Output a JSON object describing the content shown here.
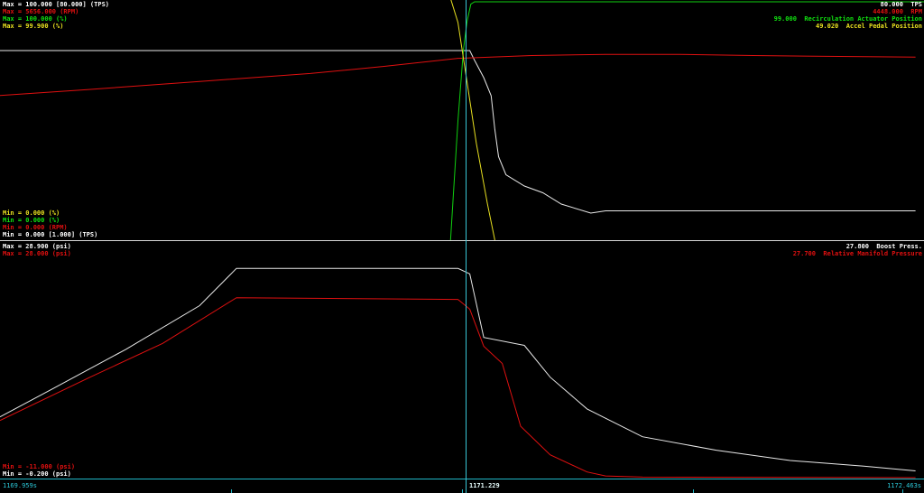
{
  "top_panel": {
    "left_labels": [
      {
        "text": "Max = 100.000 [80.000] (TPS)",
        "color": "#ffffff"
      },
      {
        "text": "Max = 5656.000 (RPM)",
        "color": "#e01010"
      },
      {
        "text": "Max = 100.000 (%)",
        "color": "#10e010"
      },
      {
        "text": "Max = 99.900 (%)",
        "color": "#e8e020"
      }
    ],
    "bottom_left_labels": [
      {
        "text": "Min = 0.000 (%)",
        "color": "#e8e020"
      },
      {
        "text": "Min = 0.000 (%)",
        "color": "#10e010"
      },
      {
        "text": "Min = 0.000 (RPM)",
        "color": "#e01010"
      },
      {
        "text": "Min = 0.000 [1.000] (TPS)",
        "color": "#ffffff"
      }
    ],
    "right_labels": [
      {
        "text": "80.000  TPS",
        "color": "#ffffff"
      },
      {
        "text": "4448.000  RPM",
        "color": "#e01010"
      },
      {
        "text": "99.000  Recirculation Actuator Position",
        "color": "#10e010"
      },
      {
        "text": "49.020  Accel Pedal Position",
        "color": "#e8e020"
      }
    ]
  },
  "bottom_panel": {
    "left_labels": [
      {
        "text": "Max = 28.900 (psi)",
        "color": "#ffffff"
      },
      {
        "text": "Max = 28.000 (psi)",
        "color": "#e01010"
      }
    ],
    "bottom_left_labels": [
      {
        "text": "Min = -11.000 (psi)",
        "color": "#e01010"
      },
      {
        "text": "Min = -0.200 (psi)",
        "color": "#ffffff"
      }
    ],
    "right_labels": [
      {
        "text": "27.800  Boost Press.",
        "color": "#ffffff"
      },
      {
        "text": "27.700  Relative Manifold Pressure",
        "color": "#e01010"
      }
    ]
  },
  "timebar": {
    "start": "1169.959s",
    "cursor": "1171.229",
    "end": "1172.463s"
  },
  "colors": {
    "tps": "#e8e8e8",
    "rpm": "#e01010",
    "recirc": "#10d010",
    "pedal": "#e8e020",
    "boost": "#e8e8e8",
    "manifold": "#e01010",
    "cursor": "#39c6d6"
  },
  "chart_data": [
    {
      "type": "line",
      "title": "",
      "xlim": [
        1169.959,
        1172.463
      ],
      "series": [
        {
          "name": "TPS",
          "color": "#e8e8e8",
          "x": [
            1169.959,
            1171.232,
            1171.244,
            1171.27,
            1171.29,
            1171.3,
            1171.31,
            1171.33,
            1171.38,
            1171.43,
            1171.48,
            1171.56,
            1171.6,
            1172.44
          ],
          "y": [
            80.0,
            80.0,
            76.0,
            68.0,
            60.0,
            45.0,
            33.0,
            25.0,
            20.0,
            17.0,
            12.0,
            8.0,
            9.0,
            9.0
          ]
        },
        {
          "name": "RPM",
          "color": "#e01010",
          "x": [
            1169.959,
            1170.2,
            1170.5,
            1170.8,
            1171.0,
            1171.2,
            1171.4,
            1171.6,
            1171.8,
            1172.0,
            1172.2,
            1172.44
          ],
          "y": [
            3400,
            3550,
            3750,
            3950,
            4130,
            4330,
            4400,
            4430,
            4430,
            4400,
            4380,
            4360
          ]
        },
        {
          "name": "Recirculation Actuator Position",
          "color": "#10d010",
          "x": [
            1171.18,
            1171.2,
            1171.215,
            1171.225,
            1171.235,
            1171.245,
            1172.463
          ],
          "y": [
            0,
            50,
            80,
            92,
            99,
            100,
            100
          ]
        },
        {
          "name": "Accel Pedal Position",
          "color": "#e8e020",
          "x": [
            1171.15,
            1171.18,
            1171.2,
            1171.22,
            1171.25,
            1171.28,
            1171.3
          ],
          "y": [
            100,
            99.9,
            90,
            70,
            40,
            15,
            0
          ]
        }
      ]
    },
    {
      "type": "line",
      "title": "",
      "xlim": [
        1169.959,
        1172.463
      ],
      "series": [
        {
          "name": "Boost Press.",
          "color": "#e8e8e8",
          "x": [
            1169.959,
            1170.1,
            1170.3,
            1170.5,
            1170.6,
            1171.0,
            1171.2,
            1171.232,
            1171.27,
            1171.38,
            1171.45,
            1171.55,
            1171.7,
            1171.9,
            1172.1,
            1172.3,
            1172.44
          ],
          "y": [
            7.0,
            10.5,
            15.5,
            21.0,
            25.7,
            25.7,
            25.7,
            25.0,
            17.0,
            16.0,
            12.0,
            8.0,
            4.5,
            2.8,
            1.5,
            0.8,
            0.2
          ]
        },
        {
          "name": "Relative Manifold Pressure",
          "color": "#e01010",
          "x": [
            1169.959,
            1170.2,
            1170.4,
            1170.6,
            1171.2,
            1171.232,
            1171.27,
            1171.32,
            1171.37,
            1171.45,
            1171.55,
            1171.6,
            1171.7,
            1172.44
          ],
          "y": [
            -5.0,
            2.5,
            8.5,
            16.5,
            16.2,
            14.5,
            8.0,
            5.0,
            -6.0,
            -11.0,
            -14.0,
            -14.7,
            -14.9,
            -15.0
          ]
        }
      ]
    }
  ]
}
